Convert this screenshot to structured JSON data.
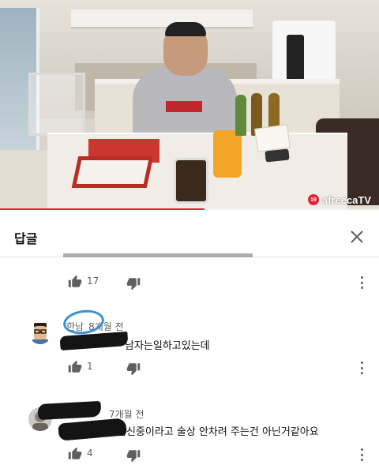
{
  "video": {
    "watermark_badge": "19",
    "watermark_text": "afreecaTV",
    "progress": 0.54,
    "accent_color": "#e0223a"
  },
  "panel": {
    "title": "답글",
    "close_icon": "close-icon"
  },
  "comments": [
    {
      "author": "",
      "time": "",
      "text": "",
      "likes": "17",
      "icons": [
        "thumb-up-icon",
        "thumb-down-icon",
        "more-vert-icon"
      ]
    },
    {
      "author": "한남",
      "time": "8개월 전",
      "text": "남자는일하고있는데",
      "likes": "1",
      "icons": [
        "avatar-icon",
        "thumb-up-icon",
        "thumb-down-icon",
        "more-vert-icon"
      ]
    },
    {
      "author": "",
      "time": "7개월 전",
      "text": "임신중이라고 술상 안차려 주는건 아닌거같아요",
      "likes": "4",
      "icons": [
        "avatar-icon",
        "thumb-up-icon",
        "thumb-down-icon",
        "more-vert-icon"
      ]
    }
  ],
  "colors": {
    "text_primary": "#0f0f0f",
    "text_secondary": "#606060",
    "divider": "#e5e5e5",
    "circle_annotation": "#3a8fd6"
  }
}
